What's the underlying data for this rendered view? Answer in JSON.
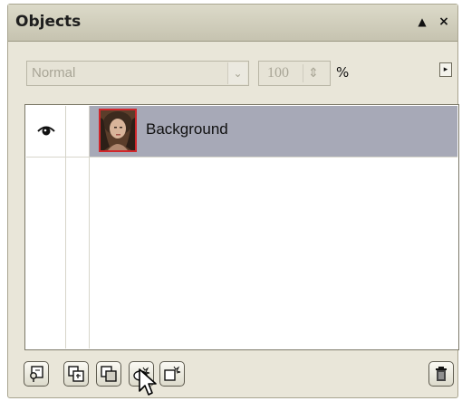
{
  "panel": {
    "title": "Objects",
    "collapse_glyph": "▲",
    "close_glyph": "×"
  },
  "toolbar": {
    "blend_mode": "Normal",
    "opacity": "100",
    "opacity_unit": "%",
    "flyout_glyph": "▸"
  },
  "layers": [
    {
      "name": "Background",
      "visible": true,
      "selected": true
    }
  ],
  "bottom_buttons": [
    {
      "name": "object-properties-icon"
    },
    {
      "name": "new-object-icon"
    },
    {
      "name": "new-object-from-selection-icon"
    },
    {
      "name": "new-lens-icon"
    },
    {
      "name": "new-lens-from-object-icon"
    },
    {
      "name": "delete-icon"
    }
  ],
  "colors": {
    "selection": "#a7a9b7",
    "thumb_border": "#d0262b",
    "panel_bg": "#e9e6d9"
  }
}
